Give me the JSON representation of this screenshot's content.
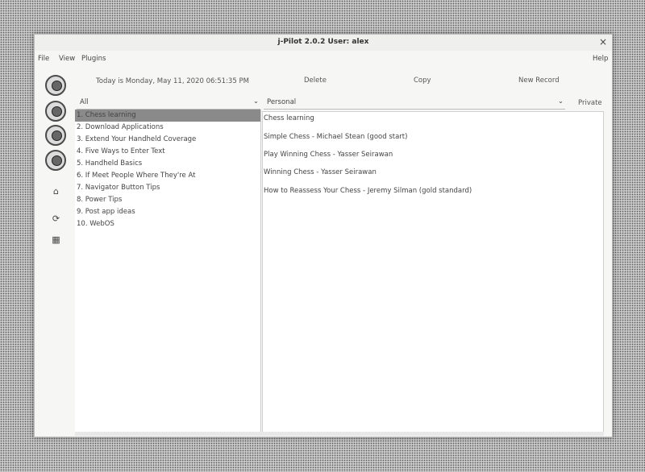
{
  "window": {
    "title": "j-Pilot 2.0.2 User: alex",
    "close_glyph": "×"
  },
  "menu": [
    "File",
    "View",
    "Plugins",
    "Help"
  ],
  "sidebar_icons": [
    "datebook-icon",
    "address-icon",
    "todo-icon",
    "memo-icon",
    "lock-icon",
    "sync-icon",
    "backup-icon"
  ],
  "date_label": "Today is Monday, May 11, 2020 06:51:35 PM",
  "category": {
    "selected": "All",
    "arrow": "⌄"
  },
  "memos": [
    "1. Chess learning",
    "2. Download Applications",
    "3. Extend Your Handheld Coverage",
    "4. Five Ways to Enter Text",
    "5. Handheld Basics",
    "6. If Meet People Where They're At",
    "7. Navigator Button Tips",
    "8. Power Tips",
    "9. Post app ideas",
    "10. WebOS"
  ],
  "buttons": {
    "delete": "Delete",
    "copy": "Copy",
    "new_record": "New Record"
  },
  "record_category": {
    "selected": "Personal",
    "arrow": "⌄"
  },
  "private_label": "Private",
  "memo_text": [
    "Chess learning",
    "",
    "Simple Chess - Michael Stean (good start)",
    "",
    "Play Winning Chess - Yasser Seirawan",
    "",
    "Winning Chess - Yasser Seirawan",
    "",
    "How to Reassess Your Chess - Jeremy Silman (gold standard)"
  ]
}
